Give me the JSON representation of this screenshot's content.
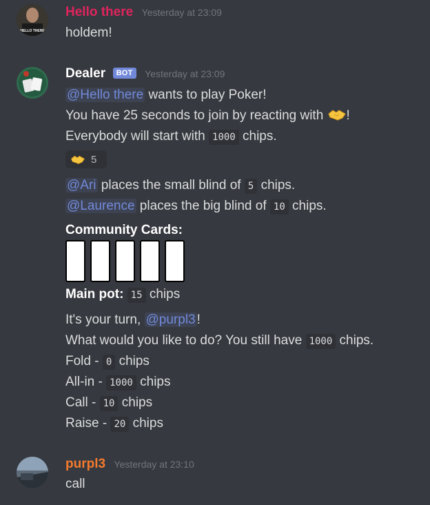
{
  "messages": {
    "m1": {
      "author": "Hello there",
      "author_color": "#e0245e",
      "timestamp": "Yesterday at 23:09",
      "text": "holdem!"
    },
    "m2": {
      "author": "Dealer",
      "author_color": "#ffffff",
      "bot_tag": "BOT",
      "timestamp": "Yesterday at 23:09",
      "l1_mention": "@Hello there",
      "l1_text": " wants to play Poker!",
      "l2_text": "You have 25 seconds to join by reacting with ",
      "l2_end": "!",
      "l3_text": "Everybody will start with ",
      "l3_code": "1000",
      "l3_end": " chips.",
      "reaction_count": "5",
      "l4_mention": "@Ari",
      "l4_text": " places the small blind of ",
      "l4_code": "5",
      "l4_end": " chips.",
      "l5_mention": "@Laurence",
      "l5_text": " places the big blind of ",
      "l5_code": "10",
      "l5_end": " chips.",
      "community_label": "Community Cards:",
      "pot_label": "Main pot:",
      "pot_code": "15",
      "pot_end": " chips",
      "turn_text": "It's your turn, ",
      "turn_mention": "@purpl3",
      "turn_end": "!",
      "ask_text": "What would you like to do? You still have ",
      "ask_code": "1000",
      "ask_end": " chips.",
      "fold_text": "Fold - ",
      "fold_code": "0",
      "fold_end": " chips",
      "allin_text": "All-in - ",
      "allin_code": "1000",
      "allin_end": " chips",
      "call_text": "Call - ",
      "call_code": "10",
      "call_end": " chips",
      "raise_text": "Raise - ",
      "raise_code": "20",
      "raise_end": " chips"
    },
    "m3": {
      "author": "purpl3",
      "author_color": "#f47b2e",
      "timestamp": "Yesterday at 23:10",
      "text": "call"
    }
  },
  "avatar_labels": {
    "m1": "HELLO THERE"
  },
  "icons": {
    "reaction": "handshake-icon"
  },
  "colors": {
    "background": "#36393f",
    "mention": "#7289da",
    "bot_tag": "#7289da"
  }
}
